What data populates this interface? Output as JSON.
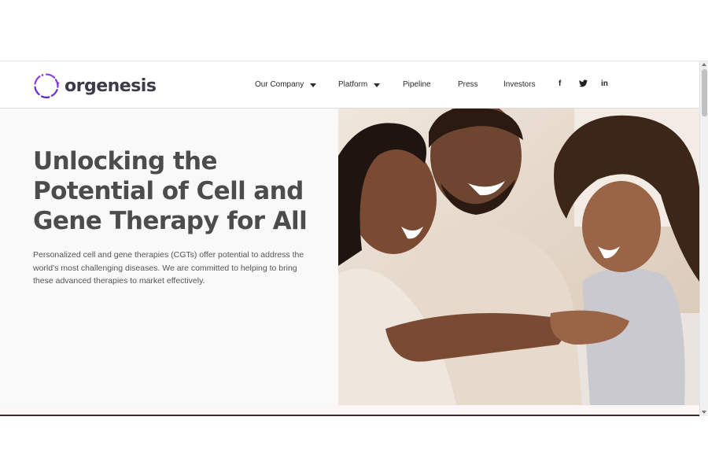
{
  "header": {
    "logo_text": "orgenesis",
    "nav": [
      {
        "label": "Our Company",
        "dropdown": true
      },
      {
        "label": "Platform",
        "dropdown": true
      },
      {
        "label": "Pipeline",
        "dropdown": false
      },
      {
        "label": "Press",
        "dropdown": false
      },
      {
        "label": "Investors",
        "dropdown": false
      }
    ],
    "social": [
      "f",
      "t",
      "in"
    ]
  },
  "hero": {
    "title_lines": [
      "Unlocking the",
      "Potential of Cell and",
      "Gene Therapy for All"
    ],
    "body": "Personalized cell and gene therapies (CGTs) offer potential to address the world's most challenging diseases. We are committed to helping to bring these advanced therapies to market effectively.",
    "image": "family-photo"
  },
  "colors": {
    "brand_purple": "#6a2bd9",
    "title_gray": "#4c4c4c"
  }
}
